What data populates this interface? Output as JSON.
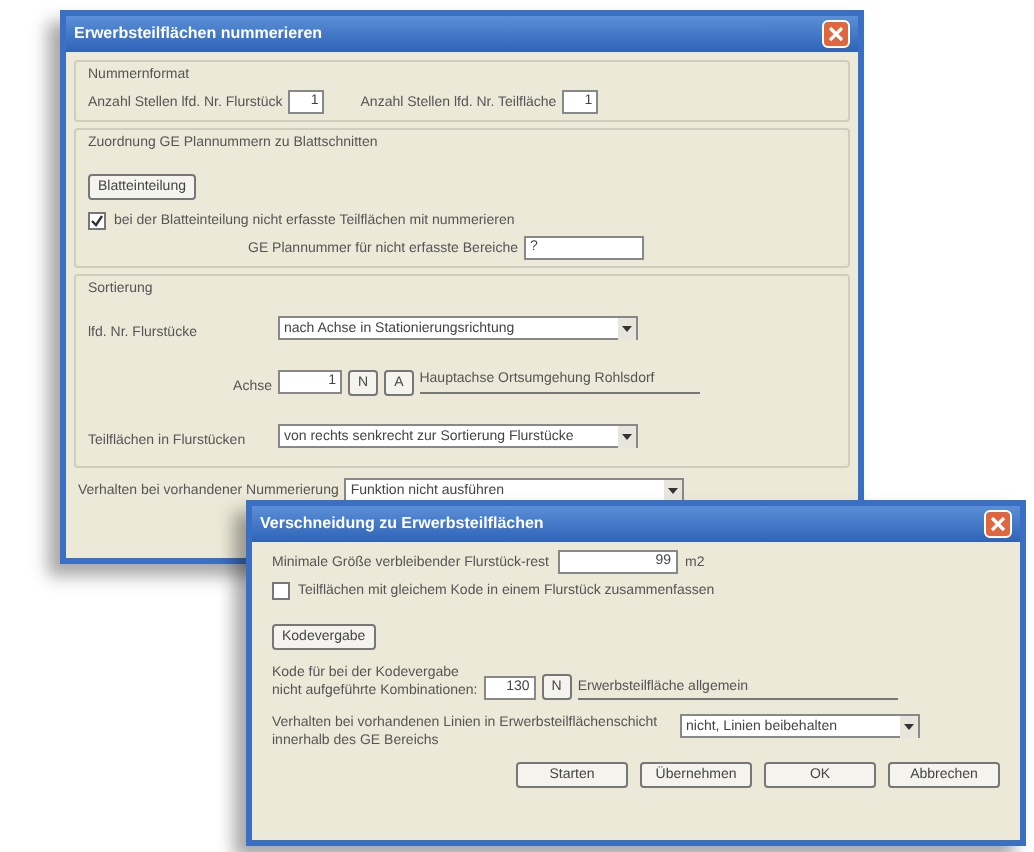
{
  "dialog_1": {
    "title": "Erwerbsteilflächen nummerieren",
    "number_format": {
      "legend": "Nummernformat",
      "fields": [
        {
          "label": "Anzahl Stellen lfd. Nr. Flurstück",
          "value": "1"
        },
        {
          "label": "Anzahl Stellen lfd. Nr. Teilfläche",
          "value": "1"
        }
      ]
    },
    "assignment": {
      "legend": "Zuordnung GE Plannummern zu Blattschnitten",
      "button": "Blatteinteilung",
      "checkbox": {
        "label": "bei der Blatteinteilung nicht erfasste Teilflächen mit nummerieren",
        "checked": true
      },
      "field": {
        "label": "GE Plannummer für nicht erfasste Bereiche",
        "value": "?"
      }
    },
    "sorting": {
      "legend": "Sortierung",
      "parcels": {
        "label": "lfd. Nr. Flurstücke",
        "value": "nach Achse in Stationierungsrichtung"
      },
      "axis": {
        "label": "Achse",
        "value": "1",
        "buttons": [
          "N",
          "A"
        ],
        "name": "Hauptachse Ortsumgehung Rohlsdorf"
      },
      "subareas": {
        "label": "Teilflächen in Flurstücken",
        "value": "von rechts senkrecht zur Sortierung Flurstücke"
      }
    },
    "behavior": {
      "label": "Verhalten bei vorhandener Nummerierung",
      "value": "Funktion nicht ausführen"
    }
  },
  "dialog_2": {
    "title": "Verschneidung zu Erwerbsteilflächen",
    "min_size": {
      "label": "Minimale Größe verbleibender Flurstück-rest",
      "value": "99",
      "unit": "m2"
    },
    "checkbox": {
      "label": "Teilflächen mit gleichem Kode in einem Flurstück zusammenfassen",
      "checked": false
    },
    "code_button": "Kodevergabe",
    "code": {
      "label_lines": [
        "Kode für bei der Kodevergabe",
        "nicht aufgeführte Kombinationen:"
      ],
      "value": "130",
      "button": "N",
      "name": "Erwerbsteilfläche allgemein"
    },
    "behavior": {
      "label_lines": [
        "Verhalten bei vorhandenen Linien in Erwerbsteilflächenschicht",
        "innerhalb des GE Bereichs"
      ],
      "value": "nicht, Linien beibehalten"
    },
    "buttons": [
      "Starten",
      "Übernehmen",
      "OK",
      "Abbrechen"
    ]
  }
}
